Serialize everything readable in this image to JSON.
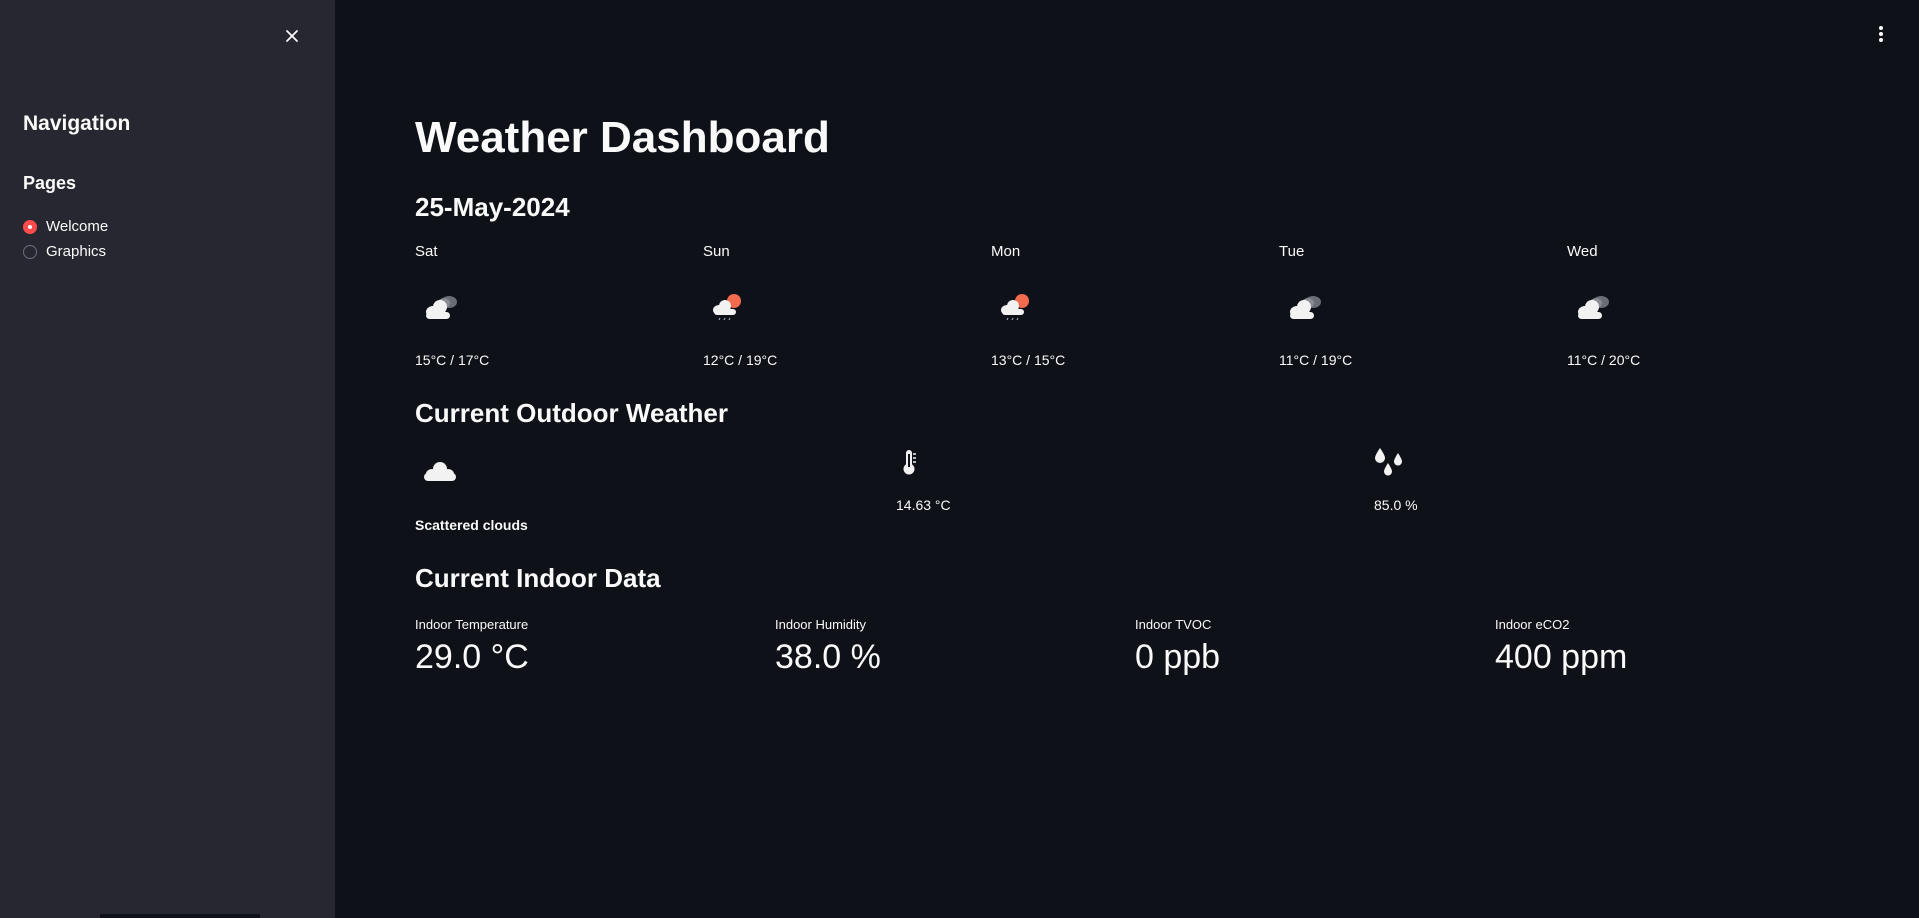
{
  "sidebar": {
    "title": "Navigation",
    "pages_title": "Pages",
    "pages": [
      {
        "label": "Welcome",
        "selected": true
      },
      {
        "label": "Graphics",
        "selected": false
      }
    ],
    "close_icon": "close-icon"
  },
  "header": {
    "menu_icon": "kebab-menu-icon"
  },
  "main": {
    "title": "Weather Dashboard",
    "date": "25-May-2024",
    "forecast": [
      {
        "day": "Sat",
        "icon": "broken-clouds-icon",
        "temp": "15°C / 17°C"
      },
      {
        "day": "Sun",
        "icon": "rain-sun-cloud-icon",
        "temp": "12°C / 19°C"
      },
      {
        "day": "Mon",
        "icon": "rain-sun-cloud-icon",
        "temp": "13°C / 15°C"
      },
      {
        "day": "Tue",
        "icon": "broken-clouds-icon",
        "temp": "11°C / 19°C"
      },
      {
        "day": "Wed",
        "icon": "broken-clouds-icon",
        "temp": "11°C / 20°C"
      }
    ],
    "outdoor": {
      "heading": "Current Outdoor Weather",
      "condition_icon": "cloud-icon",
      "condition": "Scattered clouds",
      "temperature": "14.63 °C",
      "humidity": "85.0 %"
    },
    "indoor": {
      "heading": "Current Indoor Data",
      "metrics": [
        {
          "label": "Indoor Temperature",
          "value": "29.0 °C"
        },
        {
          "label": "Indoor Humidity",
          "value": "38.0 %"
        },
        {
          "label": "Indoor TVOC",
          "value": "0 ppb"
        },
        {
          "label": "Indoor eCO2",
          "value": "400 ppm"
        }
      ]
    }
  },
  "colors": {
    "background": "#0e1117",
    "sidebar": "#262730",
    "accent": "#ff4b4b",
    "text": "#fafafa",
    "sun": "#f26b4f"
  }
}
